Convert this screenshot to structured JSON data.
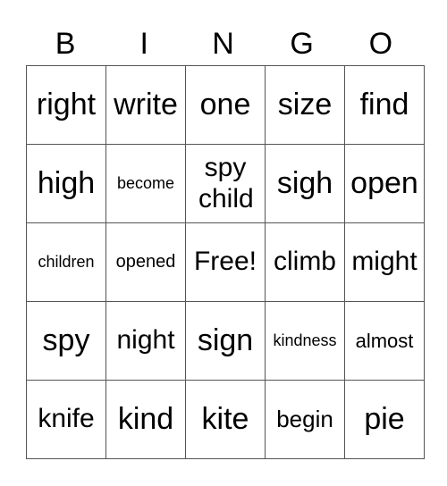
{
  "header": {
    "letters": [
      "B",
      "I",
      "N",
      "G",
      "O"
    ]
  },
  "board": {
    "rows": [
      [
        "right",
        "write",
        "one",
        "size",
        "find"
      ],
      [
        "high",
        "become",
        "spy child",
        "sigh",
        "open"
      ],
      [
        "children",
        "opened",
        "Free!",
        "climb",
        "might"
      ],
      [
        "spy",
        "night",
        "sign",
        "kindness",
        "almost"
      ],
      [
        "knife",
        "kind",
        "kite",
        "begin",
        "pie"
      ]
    ]
  }
}
